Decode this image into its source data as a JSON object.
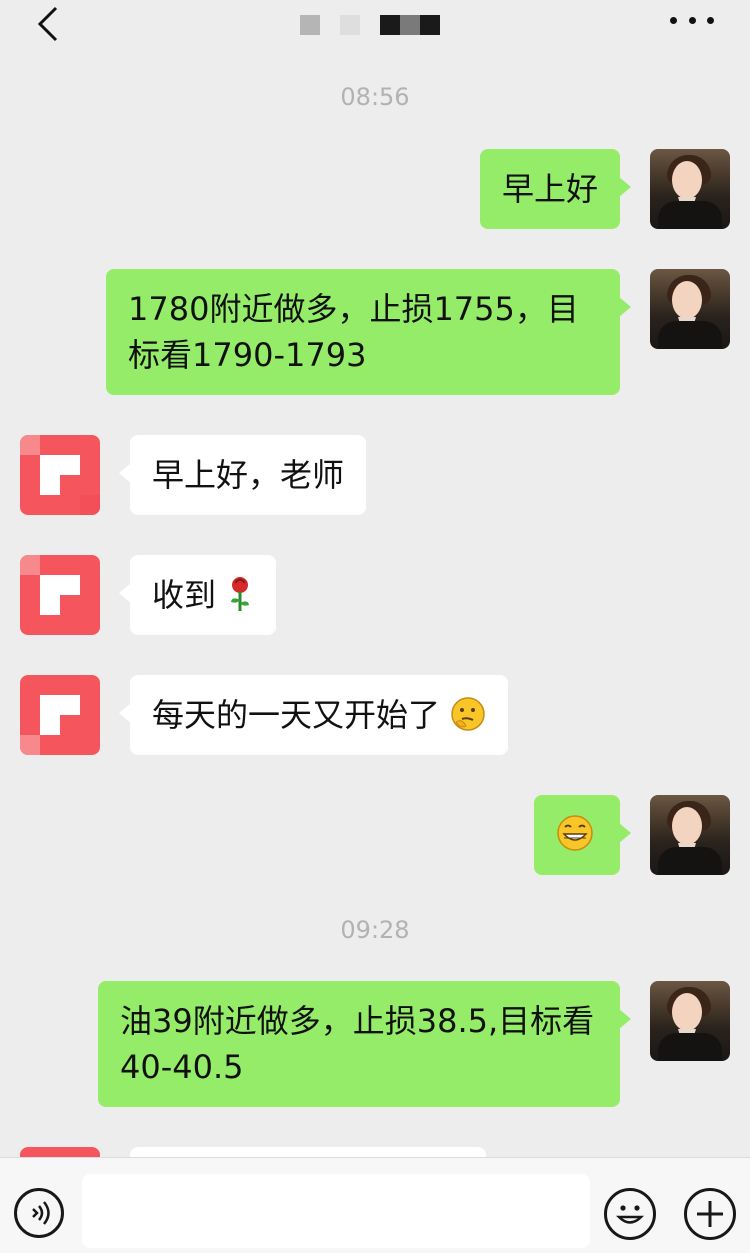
{
  "header": {
    "back_icon": "chevron-left-icon",
    "more_icon": "more-dots-icon",
    "title_redacted_colors": [
      "#b5b5b5",
      "#dedede",
      "#1a1a1a",
      "#7a7a7a",
      "#1a1a1a"
    ]
  },
  "messages": {
    "ts1": "08:56",
    "m1": "早上好",
    "m2": "1780附近做多，止损1755，目标看1790-1793",
    "m3": "早上好，老师",
    "m4_text": "收到",
    "m4_emoji": "rose-emoji",
    "m5_text": "每天的一天又开始了",
    "m5_emoji": "thinking-face-emoji",
    "m6_emoji": "grinning-face-emoji",
    "ts2": "09:28",
    "m7": "油39附近做多，止损38.5,目标看40-40.5"
  },
  "input_bar": {
    "voice_icon": "voice-icon",
    "message_value": "",
    "emoji_icon": "smiley-icon",
    "plus_icon": "plus-icon"
  },
  "colors": {
    "background": "#ededed",
    "sent_bubble": "#95ec69",
    "received_bubble": "#ffffff",
    "timestamp_text": "#b2b2b2",
    "other_avatar": "#f5565e"
  }
}
